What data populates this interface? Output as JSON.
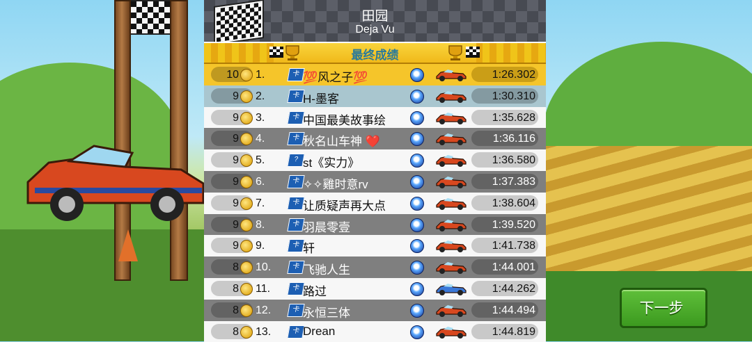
{
  "track": {
    "title": "田园",
    "subtitle": "Deja Vu"
  },
  "results": {
    "title": "最终成绩"
  },
  "rows": [
    {
      "coins": "10",
      "rank": "1.",
      "badge": "卡",
      "name": "💯风之子💯",
      "vehicle": "red-car",
      "time": "1:26.302"
    },
    {
      "coins": "9",
      "rank": "2.",
      "badge": "卡",
      "name": "H-墨客",
      "vehicle": "red-car",
      "time": "1:30.310"
    },
    {
      "coins": "9",
      "rank": "3.",
      "badge": "卡",
      "name": "中国最美故事绘",
      "vehicle": "red-car",
      "time": "1:35.628"
    },
    {
      "coins": "9",
      "rank": "4.",
      "badge": "卡",
      "name": "秋名山车神 ❤️",
      "vehicle": "red-car",
      "time": "1:36.116"
    },
    {
      "coins": "9",
      "rank": "5.",
      "badge": "?",
      "name": "st《实力》",
      "vehicle": "red-car",
      "time": "1:36.580"
    },
    {
      "coins": "9",
      "rank": "6.",
      "badge": "卡",
      "name": "✧✧雞时意rv",
      "vehicle": "red-car",
      "time": "1:37.383"
    },
    {
      "coins": "9",
      "rank": "7.",
      "badge": "卡",
      "name": "让质疑声再大点",
      "vehicle": "red-car",
      "time": "1:38.604"
    },
    {
      "coins": "9",
      "rank": "8.",
      "badge": "卡",
      "name": "羽晨零壹",
      "vehicle": "red-car",
      "time": "1:39.520"
    },
    {
      "coins": "9",
      "rank": "9.",
      "badge": "卡",
      "name": "轩",
      "vehicle": "red-car",
      "time": "1:41.738"
    },
    {
      "coins": "8",
      "rank": "10.",
      "badge": "卡",
      "name": "飞驰人生",
      "vehicle": "red-car",
      "time": "1:44.001"
    },
    {
      "coins": "8",
      "rank": "11.",
      "badge": "卡",
      "name": "路过",
      "vehicle": "blue-car",
      "time": "1:44.262"
    },
    {
      "coins": "8",
      "rank": "12.",
      "badge": "卡",
      "name": "永恒三体",
      "vehicle": "red-car",
      "time": "1:44.494"
    },
    {
      "coins": "8",
      "rank": "13.",
      "badge": "卡",
      "name": "Drean",
      "vehicle": "red-car",
      "time": "1:44.819"
    }
  ],
  "next_button": {
    "label": "下一步"
  },
  "colors": {
    "highlight": "#f5c52a",
    "button_green": "#4caf2a",
    "results_text": "#2a7a9a"
  }
}
